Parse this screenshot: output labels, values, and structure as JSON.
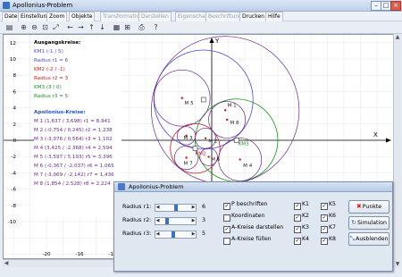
{
  "window": {
    "title": "Apollonius-Problem",
    "btn_min": "–",
    "btn_max": "□",
    "btn_close": "×"
  },
  "menu": [
    "Datei",
    "Einstellungen",
    "Zoom",
    "Objekte",
    "Transformation",
    "Darstellen",
    "Eigenschaft",
    "Beschriftung",
    "Drucken",
    "Hilfe"
  ],
  "menu_disabled": [
    "Transformation",
    "Darstellen",
    "Eigenschaft",
    "Beschriftung"
  ],
  "toolbar_icons": [
    "new-file-icon",
    "zoom-in-icon",
    "zoom-out-icon",
    "zoom-fit-icon",
    "zoom-area-icon",
    "arrow-left-icon",
    "arrow-right-icon",
    "arrow-up-icon",
    "arrow-down-icon",
    "grid-icon",
    "axes-icon",
    "print-icon",
    "help-icon"
  ],
  "toolbar_glyphs": [
    "▤",
    "⊕",
    "⊖",
    "⊡",
    "⤢",
    "←",
    "→",
    "↑",
    "↓",
    "▦",
    "⊞",
    "⎙",
    "?"
  ],
  "axes": {
    "x_label": "X",
    "y_label": "Y",
    "x_ticks": [
      "-20",
      "-16",
      "-12",
      "-8",
      "-4",
      "0",
      "4",
      "8",
      "12",
      "16"
    ],
    "y_ticks": [
      "12",
      "10",
      "8",
      "6",
      "4",
      "2",
      "0",
      "-2",
      "-4",
      "-6",
      "-8",
      "-10"
    ]
  },
  "info": {
    "heading1": "Ausgangskreise:",
    "km1": "KM1 (-1 / 5)",
    "r1": "Radius r1 = 6",
    "km2": "KM2 (-2 / -1)",
    "r2": "Radius r2 = 3",
    "km3": "KM3 (3 / 0)",
    "r3": "Radius r3 = 5",
    "heading2": "Apollonius-Kreise:",
    "m": [
      "M 1 (1,637 / 3,698)  r1 = 8,941",
      "M 2 (-0,754 / 0,245)  r2 = 1,238",
      "M 3 (-3,076 / 0,564)  r3 = 1,102",
      "M 4 (3,425 / -2,368)  r4 = 2,594",
      "M 5 (-3,597 / 5,193)  r5 = 3,396",
      "M 6 (-0,367 / -2,037)  r6 = 1,065",
      "M 7 (-3,069 / -2,142)  r7 = 1,436",
      "M 8 (1,854 / 2,528)  r8 = 2,224"
    ]
  },
  "plot_labels": {
    "m1": "M 1",
    "m5": "M 5",
    "m8": "M 8",
    "m3": "M 3",
    "m2": "M 2",
    "m6": "M 6",
    "km2": "KM2",
    "km3": "KM3",
    "m7": "M 7",
    "m4": "M 4"
  },
  "panel": {
    "title": "Apollonius-Problem",
    "radius_labels": [
      "Radius r1:",
      "Radius r2:",
      "Radius r3:"
    ],
    "radius_values": [
      "6",
      "3",
      "5"
    ],
    "checkboxes": [
      {
        "label": "P beschriften",
        "checked": true
      },
      {
        "label": "Koordinaten",
        "checked": false
      },
      {
        "label": "A-Kreise darstellen",
        "checked": true
      },
      {
        "label": "A-Kreise füllen",
        "checked": false
      }
    ],
    "k_checks": [
      "K1",
      "K2",
      "K3",
      "K4",
      "K5",
      "K6",
      "K7",
      "K8"
    ],
    "btn_punkte": "Punkte",
    "btn_simulation": "Simulation",
    "btn_ausblenden": "Ausblenden"
  },
  "colors": {
    "km1": "#4a4ad0",
    "km2": "#c21a1a",
    "km3": "#1b8f1b",
    "apollonius": "#6a2a86",
    "heading": "#1f55c8"
  }
}
